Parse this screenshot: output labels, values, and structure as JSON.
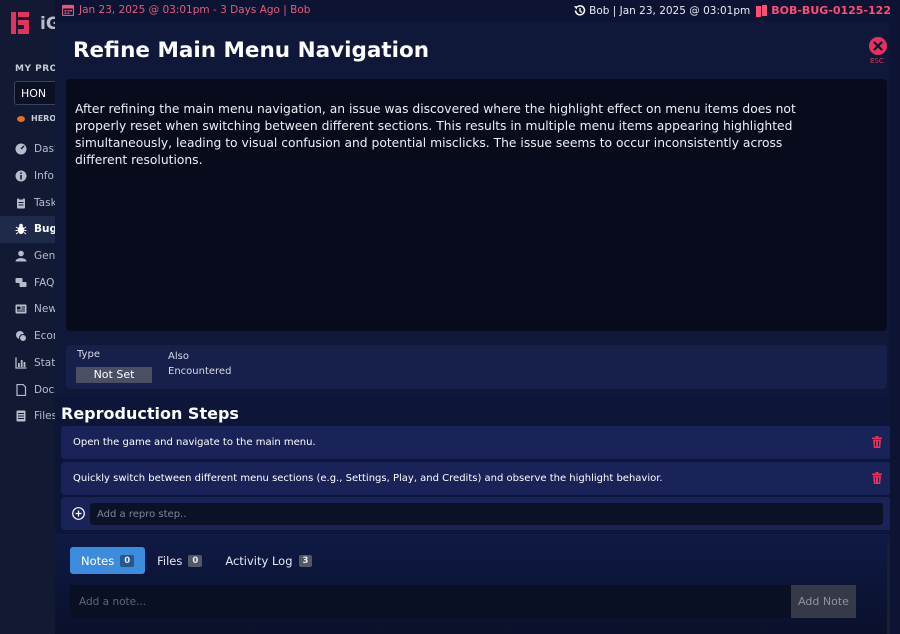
{
  "background_app": {
    "logo_text": "iG",
    "projects_label": "MY PROJECTS",
    "project_value": "HON",
    "hero_label": "HERO",
    "nav": [
      {
        "label": "Dashboard",
        "icon": "dashboard-icon",
        "active": false
      },
      {
        "label": "Info",
        "icon": "info-icon",
        "active": false
      },
      {
        "label": "Tasks",
        "icon": "clipboard-icon",
        "active": false
      },
      {
        "label": "Bugs",
        "icon": "bug-icon",
        "active": true
      },
      {
        "label": "General",
        "icon": "user-icon",
        "active": false
      },
      {
        "label": "FAQ",
        "icon": "faq-icon",
        "active": false
      },
      {
        "label": "News",
        "icon": "newspaper-icon",
        "active": false
      },
      {
        "label": "Economy",
        "icon": "economy-icon",
        "active": false
      },
      {
        "label": "Stats",
        "icon": "chart-icon",
        "active": false
      },
      {
        "label": "Docs",
        "icon": "document-icon",
        "active": false
      },
      {
        "label": "Files",
        "icon": "file-icon",
        "active": false
      }
    ]
  },
  "modal": {
    "created_info": "Jan 23, 2025 @ 03:01pm - 3 Days Ago | Bob",
    "updated_info": "Bob | Jan 23, 2025 @ 03:01pm",
    "bug_id": "BOB-BUG-0125-122",
    "title": "Refine Main Menu Navigation",
    "close_label": "ESC",
    "description": "After refining the main menu navigation, an issue was discovered where the highlight effect on menu items does not properly reset when switching between different sections. This results in multiple menu items appearing highlighted simultaneously, leading to visual confusion and potential misclicks. The issue seems to occur inconsistently across different resolutions.",
    "meta": {
      "type_label": "Type",
      "type_value": "Not Set",
      "also_label": "Also",
      "also_value": "Encountered"
    },
    "repro": {
      "title": "Reproduction Steps",
      "steps": [
        "Open the game and navigate to the main menu.",
        "Quickly switch between different menu sections (e.g., Settings, Play, and Credits) and observe the highlight behavior."
      ],
      "add_placeholder": "Add a repro step.."
    },
    "tabs": [
      {
        "label": "Notes",
        "count": "0"
      },
      {
        "label": "Files",
        "count": "0"
      },
      {
        "label": "Activity Log",
        "count": "3"
      }
    ],
    "note_placeholder": "Add a note...",
    "add_note_label": "Add Note"
  },
  "colors": {
    "accent_red": "#e3325c",
    "bug_id": "#ff4d73",
    "tab_active": "#3d8bdc",
    "modal_bg": "#10183a"
  }
}
